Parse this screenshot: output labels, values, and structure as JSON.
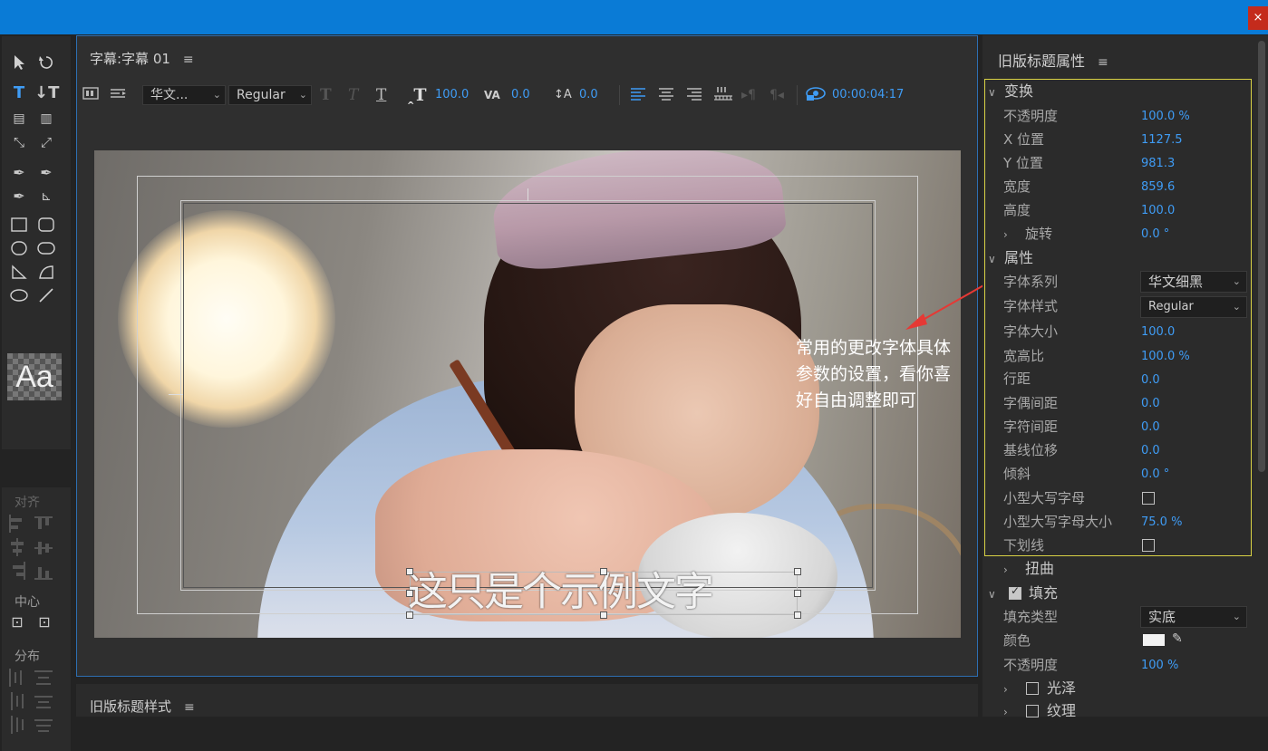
{
  "window": {
    "close_label": "×"
  },
  "tools": {
    "aa_label": "Aa"
  },
  "align_panel": {
    "label_align": "对齐",
    "label_center": "中心",
    "label_distribute": "分布"
  },
  "viewer": {
    "title": "字幕:字幕 01",
    "menu": "≡",
    "toolbar": {
      "font_family": "华文...",
      "font_style": "Regular",
      "font_size": "100.0",
      "kerning": "0.0",
      "leading": "0.0",
      "timecode": "00:00:04:17"
    },
    "subtitle_text": "这只是个示例文字",
    "annotation": "常用的更改字体具体参数的设置，看你喜好自由调整即可"
  },
  "styles_panel": {
    "title": "旧版标题样式",
    "menu": "≡"
  },
  "properties": {
    "title": "旧版标题属性",
    "menu": "≡",
    "transform": {
      "label": "变换",
      "opacity_label": "不透明度",
      "opacity": "100.0 %",
      "x_label": "X 位置",
      "x": "1127.5",
      "y_label": "Y 位置",
      "y": "981.3",
      "width_label": "宽度",
      "width": "859.6",
      "height_label": "高度",
      "height": "100.0",
      "rotation_label": "旋转",
      "rotation": "0.0 °"
    },
    "attributes": {
      "label": "属性",
      "font_family_label": "字体系列",
      "font_family": "华文细黑",
      "font_style_label": "字体样式",
      "font_style": "Regular",
      "font_size_label": "字体大小",
      "font_size": "100.0",
      "aspect_label": "宽高比",
      "aspect": "100.0 %",
      "leading_label": "行距",
      "leading": "0.0",
      "kerning_label": "字偶间距",
      "kerning": "0.0",
      "tracking_label": "字符间距",
      "tracking": "0.0",
      "baseline_label": "基线位移",
      "baseline": "0.0",
      "slant_label": "倾斜",
      "slant": "0.0 °",
      "smallcaps_label": "小型大写字母",
      "smallcaps_size_label": "小型大写字母大小",
      "smallcaps_size": "75.0 %",
      "underline_label": "下划线"
    },
    "distort": {
      "label": "扭曲"
    },
    "fill": {
      "label": "填充",
      "fill_type_label": "填充类型",
      "fill_type": "实底",
      "color_label": "颜色",
      "color": "#f2f2f2",
      "opacity_label": "不透明度",
      "opacity": "100 %",
      "sheen_label": "光泽",
      "texture_label": "纹理"
    }
  }
}
